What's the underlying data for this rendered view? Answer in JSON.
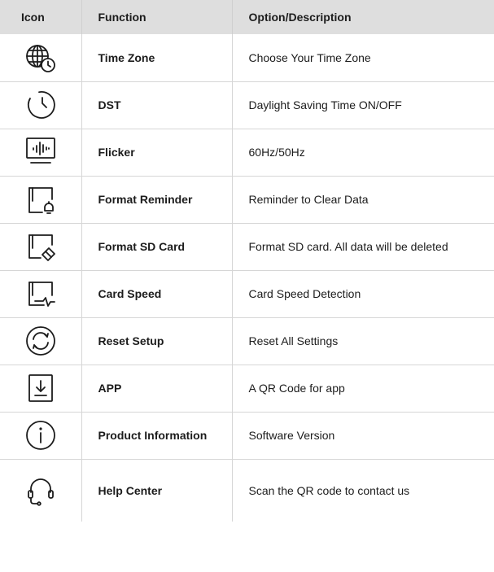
{
  "header": {
    "icon": "Icon",
    "function": "Function",
    "description": "Option/Description"
  },
  "rows": [
    {
      "icon": "globe-clock-icon",
      "function": "Time Zone",
      "description": "Choose Your Time Zone"
    },
    {
      "icon": "clock-icon",
      "function": "DST",
      "description": "Daylight Saving Time ON/OFF"
    },
    {
      "icon": "monitor-waveform-icon",
      "function": "Flicker",
      "description": "60Hz/50Hz"
    },
    {
      "icon": "sd-card-bell-icon",
      "function": "Format Reminder",
      "description": "Reminder to Clear Data"
    },
    {
      "icon": "sd-card-eraser-icon",
      "function": "Format SD Card",
      "description": "Format SD card. All data will be deleted"
    },
    {
      "icon": "sd-card-pulse-icon",
      "function": "Card Speed",
      "description": "Card Speed Detection"
    },
    {
      "icon": "reset-arrows-icon",
      "function": "Reset Setup",
      "description": "Reset All Settings"
    },
    {
      "icon": "download-icon",
      "function": "APP",
      "description": "A QR Code for app"
    },
    {
      "icon": "info-icon",
      "function": "Product Information",
      "description": "Software Version"
    },
    {
      "icon": "headset-icon",
      "function": "Help Center",
      "description": "Scan the QR code to contact us"
    }
  ]
}
